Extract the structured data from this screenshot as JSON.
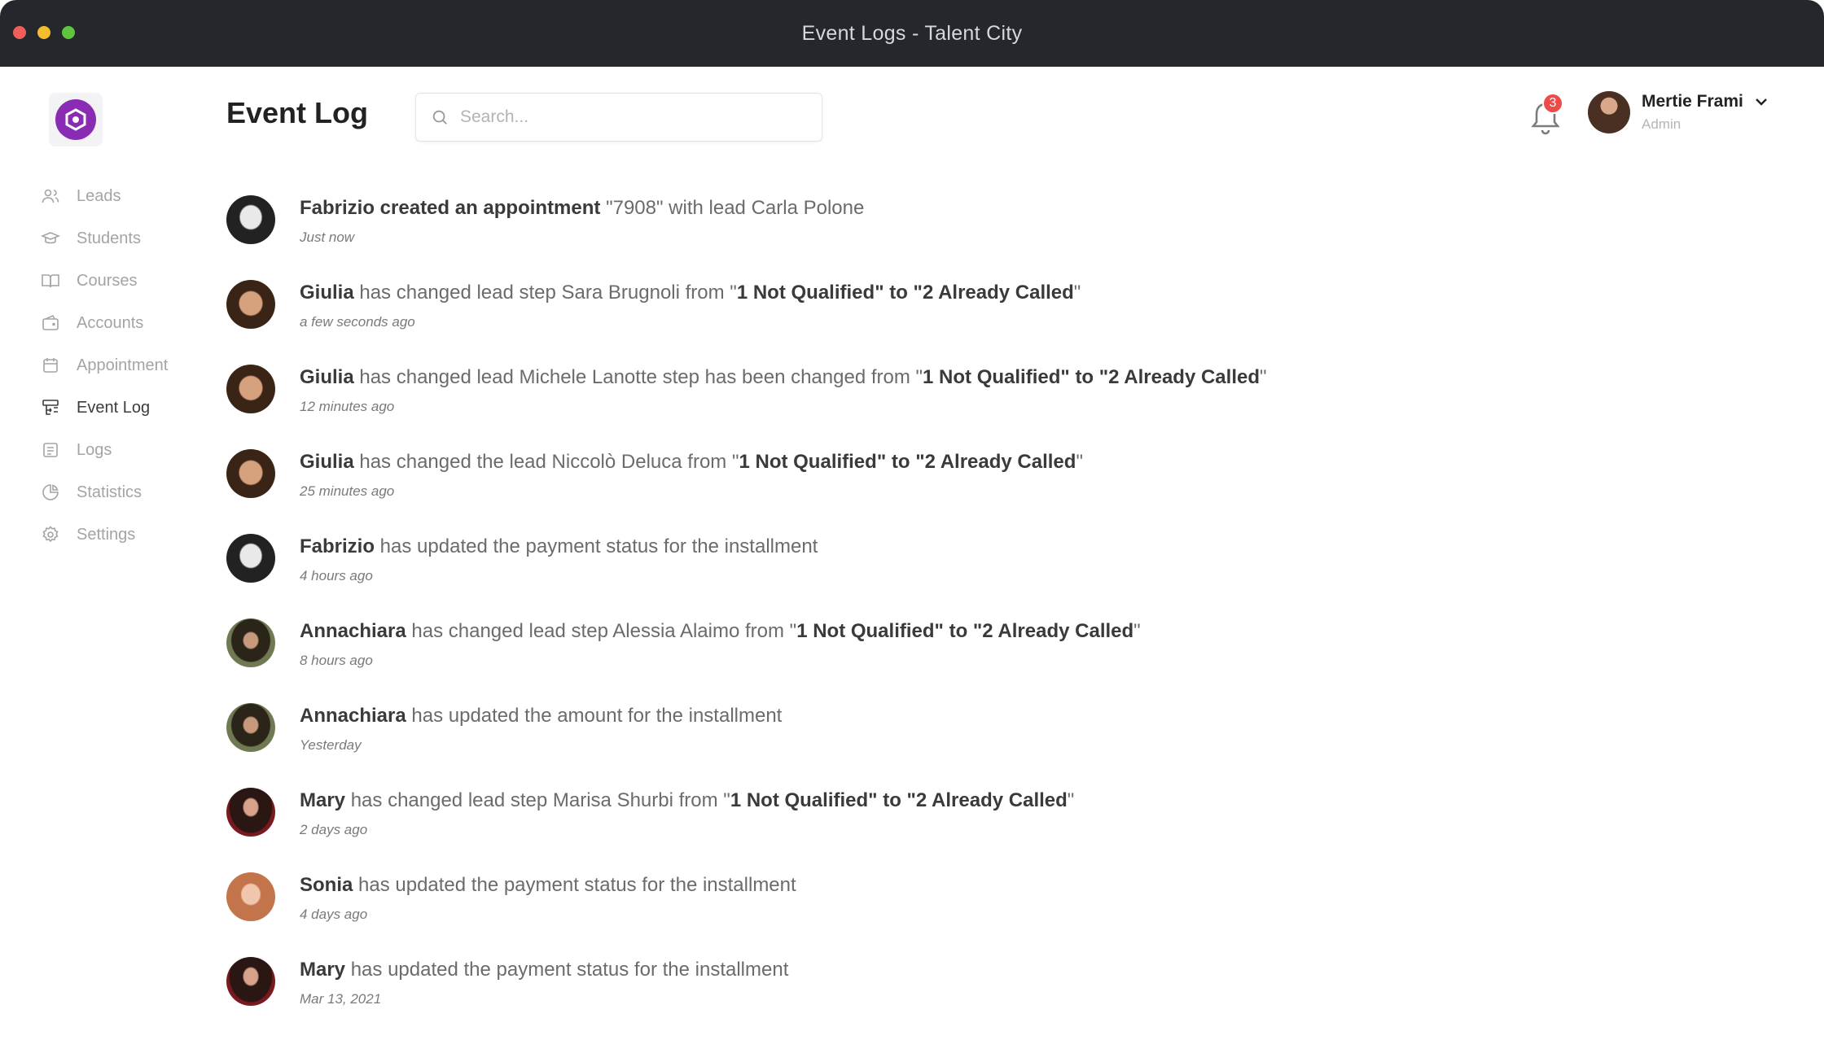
{
  "window": {
    "title": "Event Logs - Talent City"
  },
  "sidebar": {
    "items": [
      {
        "label": "Leads",
        "icon": "users-icon",
        "active": false
      },
      {
        "label": "Students",
        "icon": "graduation-cap-icon",
        "active": false
      },
      {
        "label": "Courses",
        "icon": "book-icon",
        "active": false
      },
      {
        "label": "Accounts",
        "icon": "wallet-icon",
        "active": false
      },
      {
        "label": "Appointment",
        "icon": "calendar-icon",
        "active": false
      },
      {
        "label": "Event Log",
        "icon": "event-log-icon",
        "active": true
      },
      {
        "label": "Logs",
        "icon": "list-icon",
        "active": false
      },
      {
        "label": "Statistics",
        "icon": "pie-chart-icon",
        "active": false
      },
      {
        "label": "Settings",
        "icon": "gear-icon",
        "active": false
      }
    ]
  },
  "header": {
    "title": "Event Log",
    "search_placeholder": "Search...",
    "notifications_count": "3",
    "user": {
      "name": "Mertie Frami",
      "role": "Admin"
    }
  },
  "events": [
    {
      "actor": "Fabrizio",
      "action": " created an appointment",
      "detail": " \"7908\" with lead Carla Polone",
      "time": "Just now"
    },
    {
      "actor": "Giulia",
      "action": " has changed lead step Sara Brugnoli from \"",
      "from": "1 Not Qualified",
      "mid": "\" to \"",
      "to": "2 Already Called",
      "end": "\"",
      "time": "a few seconds ago"
    },
    {
      "actor": "Giulia",
      "action": " has changed lead Michele Lanotte step has been changed from \"",
      "from": "1 Not Qualified",
      "mid": "\" to \"",
      "to": "2 Already Called",
      "end": "\"",
      "time": "12 minutes ago"
    },
    {
      "actor": "Giulia",
      "action": " has changed the lead Niccolò Deluca from \"",
      "from": "1 Not Qualified",
      "mid": "\" to \"",
      "to": "2 Already Called",
      "end": "\"",
      "time": "25 minutes ago"
    },
    {
      "actor": "Fabrizio",
      "action": " has updated the payment status for the installment",
      "time": "4 hours ago"
    },
    {
      "actor": "Annachiara",
      "action": " has changed lead step Alessia Alaimo from \"",
      "from": "1 Not Qualified",
      "mid": "\" to \"",
      "to": "2 Already Called",
      "end": "\"",
      "time": "8 hours ago"
    },
    {
      "actor": "Annachiara",
      "action": " has updated the amount for the installment",
      "time": "Yesterday"
    },
    {
      "actor": "Mary",
      "action": " has changed lead step Marisa Shurbi from \"",
      "from": "1 Not Qualified",
      "mid": "\" to \"",
      "to": "2 Already Called",
      "end": "\"",
      "time": "2 days ago"
    },
    {
      "actor": "Sonia",
      "action": " has updated the payment status for the installment",
      "time": "4 days ago"
    },
    {
      "actor": "Mary",
      "action": " has updated the payment status for the installment",
      "time": "Mar 13, 2021"
    }
  ],
  "colors": {
    "accent": "#8a2bb4",
    "badge": "#ef4a4a",
    "titlebar": "#24272b"
  }
}
